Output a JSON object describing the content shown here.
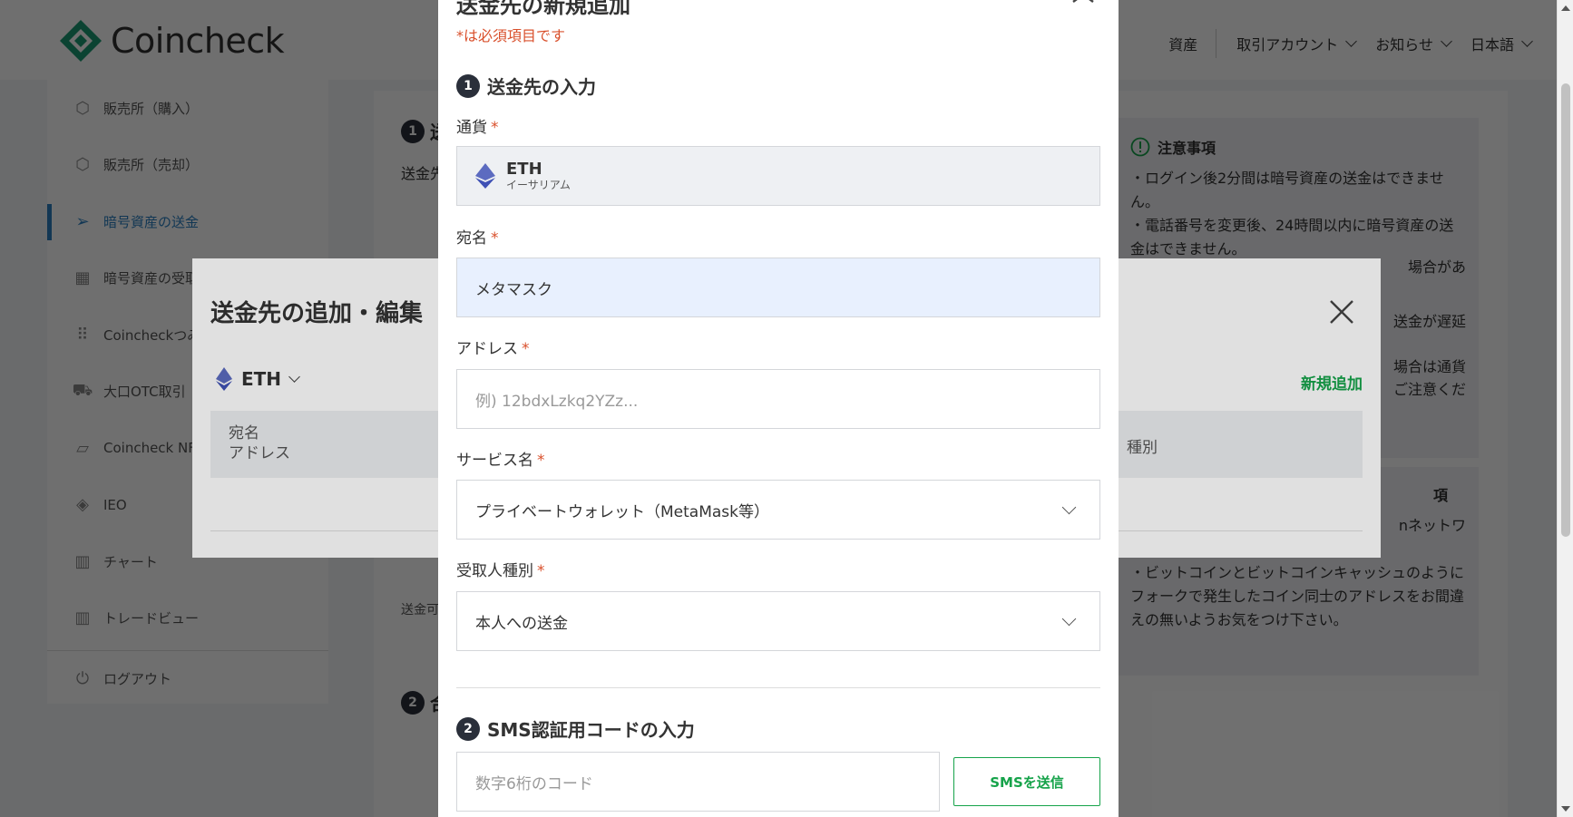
{
  "header": {
    "logo_text": "Coincheck",
    "nav": [
      "資産",
      "取引アカウント",
      "お知らせ",
      "日本語"
    ]
  },
  "sidebar": {
    "items": [
      {
        "label": "販売所（購入）",
        "icon": "cube-icon"
      },
      {
        "label": "販売所（売却）",
        "icon": "cube-icon"
      },
      {
        "label": "暗号資産の送金",
        "icon": "paper-plane-icon"
      },
      {
        "label": "暗号資産の受取",
        "icon": "qr-code-icon"
      },
      {
        "label": "Coincheckつみ",
        "icon": "coin-stack-icon"
      },
      {
        "label": "大口OTC取引",
        "icon": "truck-icon"
      },
      {
        "label": "Coincheck NFT",
        "icon": "nft-icon"
      },
      {
        "label": "IEO",
        "icon": "ieo-icon"
      },
      {
        "label": "チャート",
        "icon": "chart-icon"
      },
      {
        "label": "トレードビュー",
        "icon": "chart-icon"
      }
    ],
    "logout": "ログアウト"
  },
  "main": {
    "step1_partial": "送",
    "send_partial": "送金可",
    "step2_partial": "合",
    "send_label_partial": "送金先"
  },
  "notice": {
    "title": "注意事項",
    "text": "・ログイン後2分間は暗号資産の送金はできません。\n・電話番号を変更後、24時間以内に暗号資産の送金はできません。",
    "partial_lines": [
      "場合があ",
      "送金が遅延",
      "場合は通貨",
      "ご注意くだ"
    ]
  },
  "notice2": {
    "title_partial": "項",
    "partial_line": "nネットワ",
    "text": "・ビットコインとビットコインキャッシュのようにフォークで発生したコイン同士のアドレスをお間違えの無いようお気をつけ下さい。"
  },
  "edit_modal": {
    "title": "送金先の追加・編集",
    "coin": "ETH",
    "new_button": "新規追加",
    "col_name": "宛名",
    "col_address": "アドレス",
    "col_type": "種別"
  },
  "form": {
    "title": "送金先の新規追加",
    "required_note": "*は必須項目です",
    "section1": {
      "num": "1",
      "title": "送金先の入力"
    },
    "currency": {
      "label": "通貨",
      "req": "*",
      "code": "ETH",
      "name": "イーサリアム"
    },
    "recipient": {
      "label": "宛名",
      "req": "*",
      "value": "メタマスク"
    },
    "address": {
      "label": "アドレス",
      "req": "*",
      "placeholder": "例) 12bdxLzkq2YZz..."
    },
    "service": {
      "label": "サービス名",
      "req": "*",
      "value": "プライベートウォレット（MetaMask等）"
    },
    "receiver_type": {
      "label": "受取人種別",
      "req": "*",
      "value": "本人への送金"
    },
    "section2": {
      "num": "2",
      "title": "SMS認証用コードの入力"
    },
    "sms": {
      "placeholder": "数字6桁のコード",
      "button": "SMSを送信"
    }
  },
  "colors": {
    "accent_green": "#16a34a",
    "required_red": "#d9502c",
    "active_blue": "#2a7fc1"
  }
}
